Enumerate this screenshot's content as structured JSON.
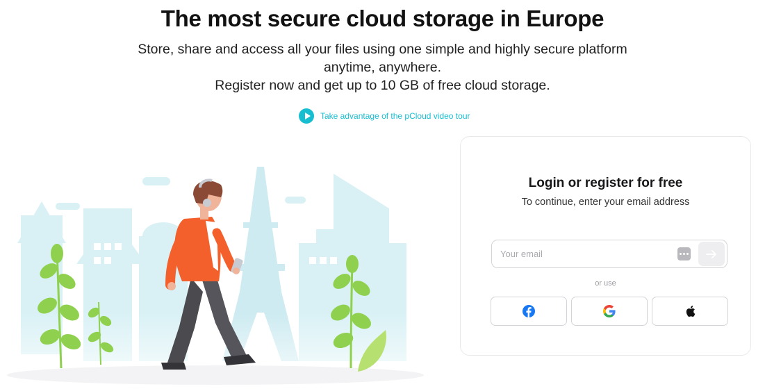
{
  "hero": {
    "title": "The most secure cloud storage in Europe",
    "subtitle_line1": "Store, share and access all your files using one simple and highly secure platform",
    "subtitle_line2": "anytime, anywhere.",
    "subtitle_line3": "Register now and get up to 10 GB of free cloud storage."
  },
  "video_tour": {
    "icon": "play-icon",
    "label": "Take advantage of the pCloud video tour"
  },
  "login": {
    "title": "Login or register for free",
    "subtitle": "To continue, enter your email address",
    "email_placeholder": "Your email",
    "email_value": "",
    "or_use": "or use",
    "social": [
      {
        "name": "Facebook",
        "icon": "facebook-icon"
      },
      {
        "name": "Google",
        "icon": "google-icon"
      },
      {
        "name": "Apple",
        "icon": "apple-icon"
      }
    ]
  },
  "colors": {
    "accent": "#17bed0",
    "text": "#17171a",
    "facebook": "#1877f2",
    "illustration_buildings": "#d6f0f4",
    "shirt": "#f4602b",
    "pants": "#4a4a4f",
    "leaf": "#8fd14f"
  }
}
